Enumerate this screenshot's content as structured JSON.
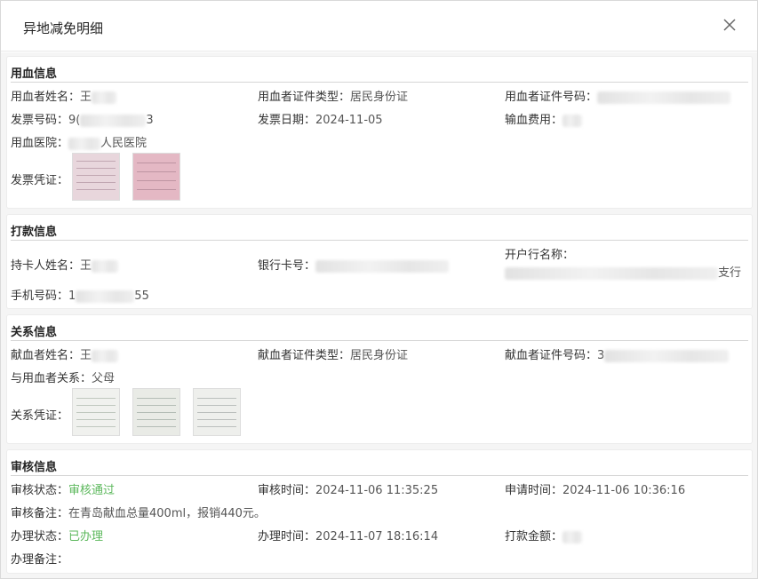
{
  "dialog": {
    "title": "异地减免明细"
  },
  "blood_info": {
    "section_title": "用血信息",
    "user_name_label": "用血者姓名：",
    "user_name_value": "王",
    "id_type_label": "用血者证件类型：",
    "id_type_value": "居民身份证",
    "id_no_label": "用血者证件号码：",
    "invoice_no_label": "发票号码：",
    "invoice_no_prefix": "9(",
    "invoice_no_suffix": "3",
    "invoice_date_label": "发票日期：",
    "invoice_date_value": "2024-11-05",
    "fee_label": "输血费用：",
    "hospital_label": "用血医院：",
    "hospital_value": "人民医院",
    "voucher_label": "发票凭证："
  },
  "payment_info": {
    "section_title": "打款信息",
    "holder_label": "持卡人姓名：",
    "holder_value": "王",
    "card_label": "银行卡号：",
    "bank_label": "开户行名称：",
    "bank_value_suffix": "支行",
    "phone_label": "手机号码：",
    "phone_prefix": "1",
    "phone_suffix": "55"
  },
  "relation_info": {
    "section_title": "关系信息",
    "donor_name_label": "献血者姓名：",
    "donor_name_value": "王",
    "donor_id_type_label": "献血者证件类型：",
    "donor_id_type_value": "居民身份证",
    "donor_id_no_label": "献血者证件号码：",
    "donor_id_no_prefix": "3",
    "relation_label": "与用血者关系：",
    "relation_value": "父母",
    "voucher_label": "关系凭证："
  },
  "audit_info": {
    "section_title": "审核信息",
    "status_label": "审核状态：",
    "status_value": "审核通过",
    "audit_time_label": "审核时间：",
    "audit_time_value": "2024-11-06 11:35:25",
    "apply_time_label": "申请时间：",
    "apply_time_value": "2024-11-06 10:36:16",
    "remark_label": "审核备注：",
    "remark_value": "在青岛献血总量400ml，报销440元。",
    "process_status_label": "办理状态：",
    "process_status_value": "已办理",
    "process_time_label": "办理时间：",
    "process_time_value": "2024-11-07 18:16:14",
    "amount_label": "打款金额：",
    "process_remark_label": "办理备注："
  },
  "colors": {
    "success": "#5cb85c",
    "divider": "#d6d6d6"
  }
}
